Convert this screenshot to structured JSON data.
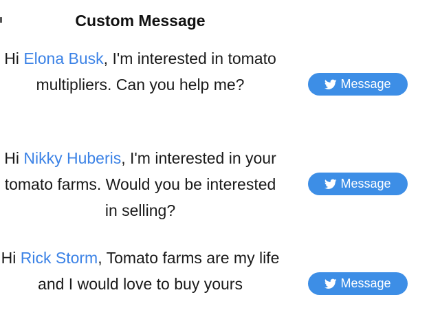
{
  "page": {
    "heading": "Custom Message"
  },
  "messages": [
    {
      "greeting": "Hi ",
      "name": "Elona Busk",
      "text": ", I'm interested in tomato multipliers. Can you help me?",
      "button_label": "Message",
      "button_icon": "twitter-bird-icon"
    },
    {
      "greeting": "Hi ",
      "name": "Nikky Huberis",
      "text": ", I'm interested in your tomato farms. Would you be interested in selling?",
      "button_label": "Message",
      "button_icon": "twitter-bird-icon"
    },
    {
      "greeting": "Hi ",
      "name": "Rick Storm",
      "text": ", Tomato farms are my life and I would love to buy yours",
      "button_label": "Message",
      "button_icon": "twitter-bird-icon"
    }
  ],
  "colors": {
    "link": "#3b82e6",
    "button_bg": "#3d8ee6",
    "button_text": "#ffffff"
  }
}
